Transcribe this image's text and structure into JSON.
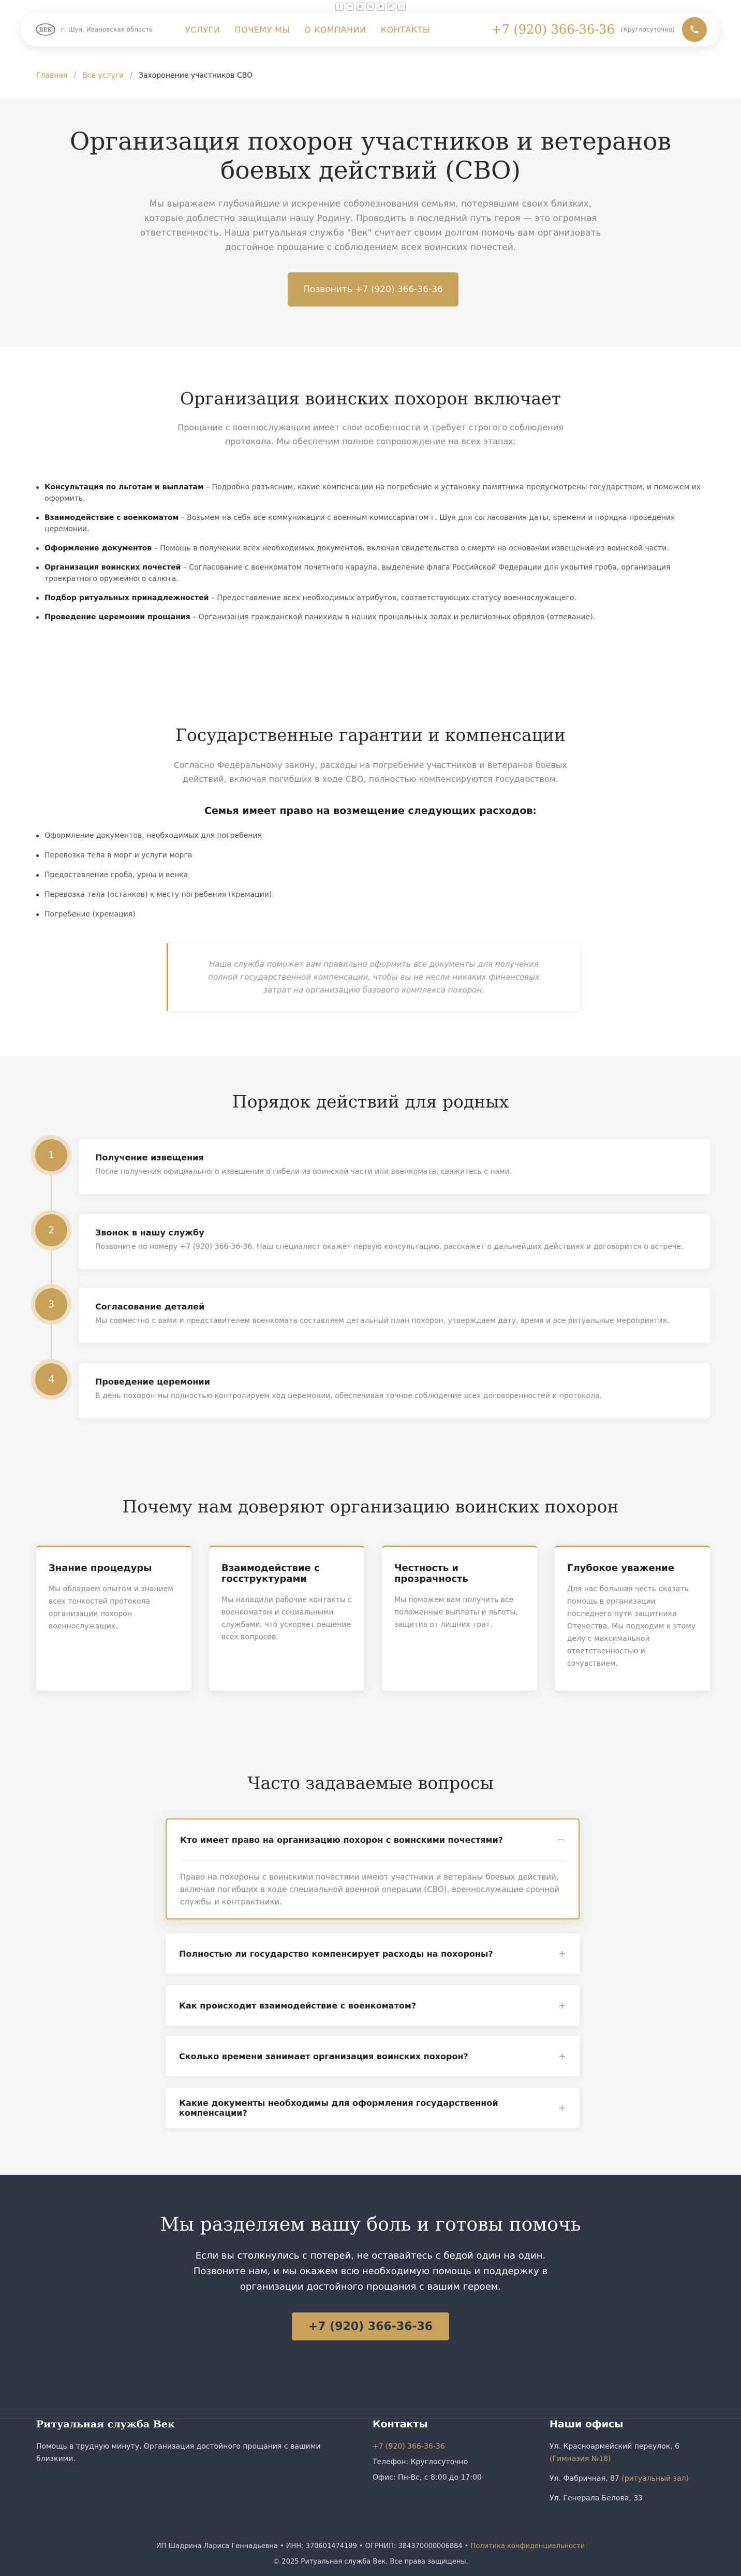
{
  "header": {
    "region": "г. Шуя, Ивановская область",
    "nav": [
      "УСЛУГИ",
      "ПОЧЕМУ МЫ",
      "О КОМПАНИИ",
      "КОНТАКТЫ"
    ],
    "phone": "+7 (920) 366-36-36",
    "phone_note": "(Круглосуточно)"
  },
  "breadcrumbs": {
    "home": "Главная",
    "services": "Все услуги",
    "current": "Захоронение участников СВО"
  },
  "hero": {
    "title": "Организация похорон участников и ветеранов боевых действий (СВО)",
    "text": "Мы выражаем глубочайшие и искренние соболезнования семьям, потерявшим своих близких, которые доблестно защищали нашу Родину. Проводить в последний путь героя — это огромная ответственность. Наша ритуальная служба \"Век\" считает своим долгом помочь вам организовать достойное прощание с соблюдением всех воинских почестей.",
    "button": "Позвонить +7 (920) 366-36-36"
  },
  "includes": {
    "title": "Организация воинских похорон включает",
    "subtitle": "Прощание с военнослужащим имеет свои особенности и требует строгого соблюдения протокола. Мы обеспечим полное сопровождение на всех этапах:",
    "items": [
      {
        "bold": "Консультация по льготам и выплатам",
        "text": " – Подробно разъясним, какие компенсации на погребение и установку памятника предусмотрены государством, и поможем их оформить."
      },
      {
        "bold": "Взаимодействие с военкоматом",
        "text": " – Возьмем на себя все коммуникации с военным комиссариатом г. Шуя для согласования даты, времени и порядка проведения церемонии."
      },
      {
        "bold": "Оформление документов",
        "text": " – Помощь в получении всех необходимых документов, включая свидетельство о смерти на основании извещения из воинской части."
      },
      {
        "bold": "Организация воинских почестей",
        "text": " – Согласование с военкоматом почетного караула, выделение флага Российской Федерации для укрытия гроба, организация троекратного оружейного салюта."
      },
      {
        "bold": "Подбор ритуальных принадлежностей",
        "text": " – Предоставление всех необходимых атрибутов, соответствующих статусу военнослужащего."
      },
      {
        "bold": "Проведение церемонии прощания",
        "text": " – Организация гражданской панихиды в наших прощальных залах и религиозных обрядов (отпевание)."
      }
    ]
  },
  "guarantees": {
    "title": "Государственные гарантии и компенсации",
    "subtitle": "Согласно Федеральному закону, расходы на погребение участников и ветеранов боевых действий, включая погибших в ходе СВО, полностью компенсируются государством.",
    "list_title": "Семья имеет право на возмещение следующих расходов:",
    "items": [
      "Оформление документов, необходимых для погребения",
      "Перевозка тела в морг и услуги морга",
      "Предоставление гроба, урны и венка",
      "Перевозка тела (останков) к месту погребения (кремации)",
      "Погребение (кремация)"
    ],
    "note": "Наша служба поможет вам правильно оформить все документы для получения полной государственной компенсации, чтобы вы не несли никаких финансовых затрат на организацию базового комплекса похорон."
  },
  "steps": {
    "title": "Порядок действий для родных",
    "items": [
      {
        "num": "1",
        "title": "Получение извещения",
        "text": "После получения официального извещения о гибели из воинской части или военкомата, свяжитесь с нами."
      },
      {
        "num": "2",
        "title": "Звонок в нашу службу",
        "text": "Позвоните по номеру +7 (920) 366-36-36. Наш специалист окажет первую консультацию, расскажет о дальнейших действиях и договорится о встрече."
      },
      {
        "num": "3",
        "title": "Согласование деталей",
        "text": "Мы совместно с вами и представителем военкомата составляем детальный план похорон, утверждаем дату, время и все ритуальные мероприятия."
      },
      {
        "num": "4",
        "title": "Проведение церемонии",
        "text": "В день похорон мы полностью контролируем ход церемонии, обеспечивая точное соблюдение всех договоренностей и протокола."
      }
    ]
  },
  "trust": {
    "title": "Почему нам доверяют организацию воинских похорон",
    "cards": [
      {
        "title": "Знание процедуры",
        "text": "Мы обладаем опытом и знанием всех тонкостей протокола организации похорон военнослужащих."
      },
      {
        "title": "Взаимодействие с госструктурами",
        "text": "Мы наладили рабочие контакты с военкоматом и социальными службами, что ускоряет решение всех вопросов."
      },
      {
        "title": "Честность и прозрачность",
        "text": "Мы поможем вам получить все положенные выплаты и льготы, защитив от лишних трат."
      },
      {
        "title": "Глубокое уважение",
        "text": "Для нас большая честь оказать помощь в организации последнего пути защитника Отечества. Мы подходим к этому делу с максимальной ответственностью и сочувствием."
      }
    ]
  },
  "faq": {
    "title": "Часто задаваемые вопросы",
    "items": [
      {
        "q": "Кто имеет право на организацию похорон с воинскими почестями?",
        "a": "Право на похороны с воинскими почестями имеют участники и ветераны боевых действий, включая погибших в ходе специальной военной операции (СВО), военнослужащие срочной службы и контрактники.",
        "toggle": "−"
      },
      {
        "q": "Полностью ли государство компенсирует расходы на похороны?",
        "toggle": "+"
      },
      {
        "q": "Как происходит взаимодействие с военкоматом?",
        "toggle": "+"
      },
      {
        "q": "Сколько времени занимает организация воинских похорон?",
        "toggle": "+"
      },
      {
        "q": "Какие документы необходимы для оформления государственной компенсации?",
        "toggle": "+"
      }
    ]
  },
  "cta": {
    "title": "Мы разделяем вашу боль и готовы помочь",
    "text": "Если вы столкнулись с потерей, не оставайтесь с бедой один на один. Позвоните нам, и мы окажем всю необходимую помощь и поддержку в организации достойного прощания с вашим героем.",
    "button": "+7 (920) 366-36-36"
  },
  "footer": {
    "brand": "Ритуальная служба Век",
    "brand_text": "Помощь в трудную минуту. Организация достойного прощания с вашими близкими.",
    "contacts_title": "Контакты",
    "phone": "+7 (920) 366-36-36",
    "phone_note": "Телефон: Круглосуточно",
    "hours": "Офис: Пн-Вс, с 8:00 до 17:00",
    "offices_title": "Наши офисы",
    "offices": [
      {
        "addr": "Ул. Красноармейский переулок, 6",
        "link": "(Гимназия №18)"
      },
      {
        "addr": "Ул. Фабричная, 87",
        "link": "(ритуальный зал)"
      },
      {
        "addr": "Ул. Генерала Белова, 33",
        "link": ""
      }
    ],
    "legal": "ИП Шадрина Лариса Геннадьевна • ИНН: 370601474199 • ОГРНИП: 384370000006884 •",
    "policy": "Политика конфиденциальности",
    "copyright": "© 2025 Ритуальная служба Век. Все права защищены."
  }
}
